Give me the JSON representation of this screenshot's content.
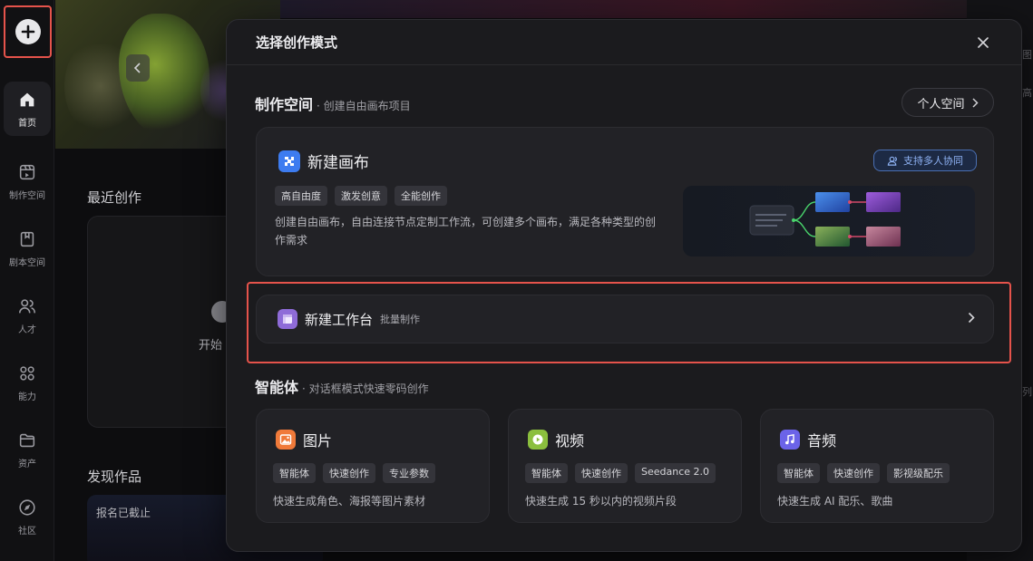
{
  "sidebar": {
    "items": [
      {
        "label": "首页",
        "icon": "home-icon",
        "active": true
      },
      {
        "label": "制作空间",
        "icon": "studio-icon"
      },
      {
        "label": "剧本空间",
        "icon": "script-icon"
      },
      {
        "label": "人才",
        "icon": "people-icon"
      },
      {
        "label": "能力",
        "icon": "apps-icon"
      },
      {
        "label": "资产",
        "icon": "folder-icon"
      },
      {
        "label": "社区",
        "icon": "compass-icon"
      }
    ]
  },
  "background": {
    "recent_title": "最近创作",
    "recent_start": "开始",
    "discover_title": "发现作品",
    "discover_badge": "报名已截止",
    "right_t1": "图",
    "right_t2": "高",
    "right_t3": "列"
  },
  "modal": {
    "title": "选择创作模式",
    "studio": {
      "title": "制作空间",
      "subtitle": "· 创建自由画布项目",
      "personal_button": "个人空间"
    },
    "canvas_card": {
      "title": "新建画布",
      "tags": [
        "高自由度",
        "激发创意",
        "全能创作"
      ],
      "description": "创建自由画布，自由连接节点定制工作流，可创建多个画布，满足各种类型的创作需求",
      "collab_badge": "支持多人协同"
    },
    "workbench_card": {
      "title": "新建工作台",
      "subtitle": "批量制作"
    },
    "agents": {
      "title": "智能体",
      "subtitle": "· 对话框模式快速零码创作",
      "cards": [
        {
          "title": "图片",
          "tags": [
            "智能体",
            "快速创作",
            "专业参数"
          ],
          "description": "快速生成角色、海报等图片素材",
          "color": "#f07a3a"
        },
        {
          "title": "视频",
          "tags": [
            "智能体",
            "快速创作",
            "Seedance 2.0"
          ],
          "description": "快速生成 15 秒以内的视频片段",
          "color": "#8bbf3e"
        },
        {
          "title": "音频",
          "tags": [
            "智能体",
            "快速创作",
            "影视级配乐"
          ],
          "description": "快速生成 AI 配乐、歌曲",
          "color": "#6b63e8"
        }
      ]
    }
  },
  "colors": {
    "highlight": "#e5534b",
    "canvas_icon": "#3d7cf0",
    "workbench_icon": "#8e6bd8",
    "collab": "#8fb3f5"
  }
}
